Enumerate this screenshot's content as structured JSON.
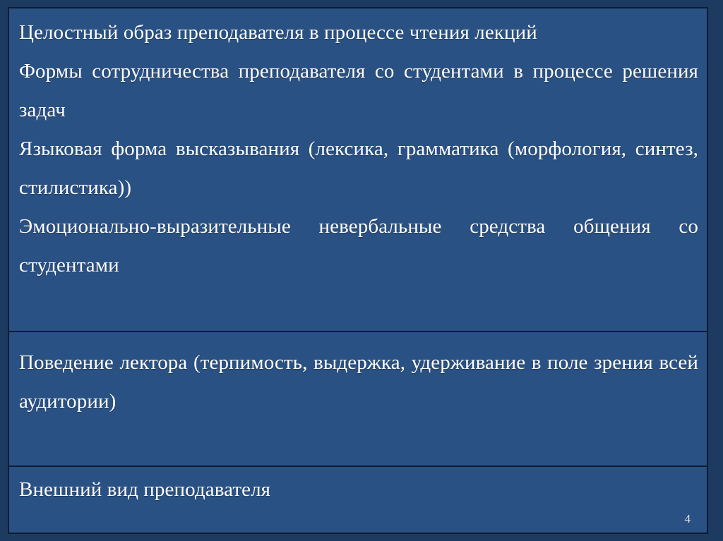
{
  "slide": {
    "background_color": "#1d3a60",
    "cell_color": "#2a5183",
    "border_color": "#0d1c2e",
    "text_color": "#ffffff",
    "page_number": "4"
  },
  "table": {
    "rows": [
      {
        "paragraphs": [
          "Целостный образ преподавателя в процессе чтения лекций",
          "Формы сотрудничества преподавателя со студентами в процессе решения задач",
          "Языковая форма высказывания (лексика, грамматика (морфология, синтез, стилистика))",
          "Эмоционально-выразительные невербальные средства общения со студентами"
        ]
      },
      {
        "paragraphs": [
          "Поведение лектора (терпимость, выдержка, удерживание в поле зрения всей аудитории)"
        ]
      },
      {
        "paragraphs": [
          "Внешний вид преподавателя"
        ]
      }
    ]
  }
}
